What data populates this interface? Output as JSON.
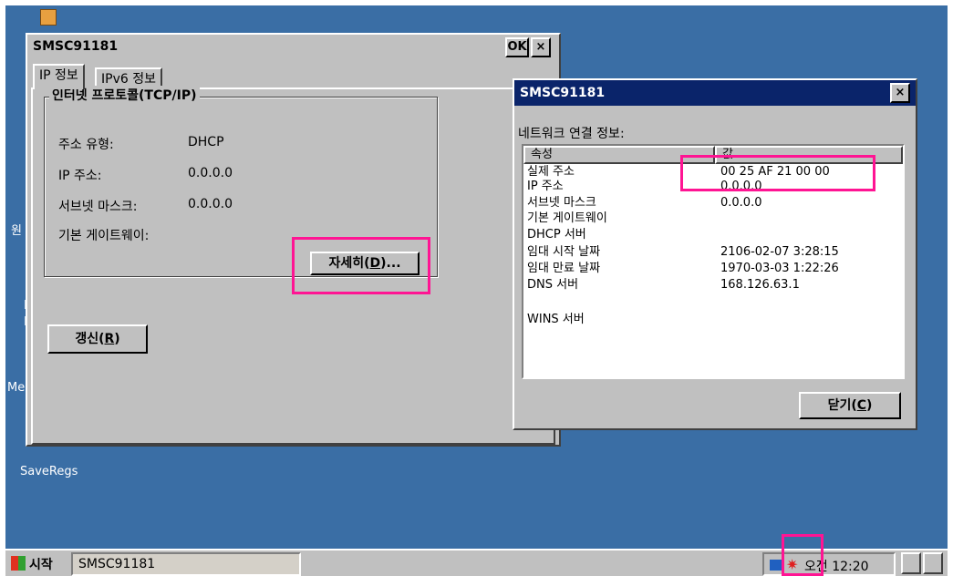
{
  "desktop": {
    "icon_labels": [
      "원",
      "I",
      "E",
      "Me",
      "SaveRegs"
    ]
  },
  "ipconfig_window": {
    "title": "SMSC91181",
    "ok_button": "OK",
    "close_button": "×",
    "tabs": [
      "IP 정보",
      "IPv6 정보"
    ],
    "group_title": "인터넷 프로토콜(TCP/IP)",
    "fields": [
      {
        "label": "주소 유형:",
        "value": "DHCP"
      },
      {
        "label": "IP 주소:",
        "value": "0.0.0.0"
      },
      {
        "label": "서브넷 마스크:",
        "value": "0.0.0.0"
      },
      {
        "label": "기본 게이트웨이:",
        "value": ""
      }
    ],
    "details_button": {
      "prefix": "자세히(",
      "mnemonic": "D",
      "suffix": ")..."
    },
    "refresh_button": {
      "prefix": "갱신(",
      "mnemonic": "R",
      "suffix": ")"
    }
  },
  "details_window": {
    "title": "SMSC91181",
    "close_button": "×",
    "caption": "네트워크 연결 정보:",
    "columns": [
      "속성",
      "값"
    ],
    "rows": [
      {
        "property": "실제 주소",
        "value": "00 25 AF 21 00 00"
      },
      {
        "property": "IP 주소",
        "value": "0.0.0.0"
      },
      {
        "property": "서브넷 마스크",
        "value": "0.0.0.0"
      },
      {
        "property": "기본 게이트웨이",
        "value": ""
      },
      {
        "property": "DHCP 서버",
        "value": ""
      },
      {
        "property": "임대 시작 날짜",
        "value": "2106-02-07 3:28:15"
      },
      {
        "property": "임대 만료 날짜",
        "value": "1970-03-03 1:22:26"
      },
      {
        "property": "DNS 서버",
        "value": "168.126.63.1"
      },
      {
        "property": "",
        "value": ""
      },
      {
        "property": "WINS 서버",
        "value": ""
      }
    ],
    "close_label": {
      "prefix": "닫기(",
      "mnemonic": "C",
      "suffix": ")"
    }
  },
  "taskbar": {
    "start_label": "시작",
    "task_button": "SMSC91181",
    "clock": "오전 12:20"
  },
  "colors": {
    "desktop": "#3a6ea5",
    "title_active": "#0a246a",
    "highlight": "#ff1493"
  }
}
